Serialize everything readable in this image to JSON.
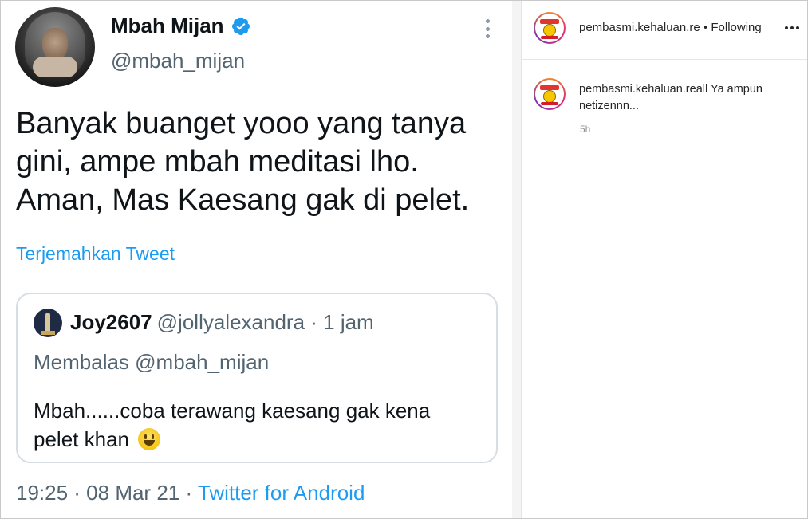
{
  "tweet": {
    "display_name": "Mbah Mijan",
    "handle": "@mbah_mijan",
    "text_lines": [
      "Banyak buanget yooo yang tanya",
      "gini, ampe mbah meditasi lho.",
      "Aman, Mas Kaesang gak di pelet."
    ],
    "translate_label": "Terjemahkan Tweet",
    "quote": {
      "name": "Joy2607",
      "handle_time": "@jollyalexandra · 1 jam",
      "reply_to": "Membalas @mbah_mijan",
      "text_line1": "Mbah......coba terawang kaesang gak kena",
      "text_line2": "pelet khan"
    },
    "timestamp": "19:25 · 08 Mar 21 · ",
    "source": "Twitter for Android"
  },
  "instagram": {
    "header_username": "pembasmi.kehaluan.re",
    "header_following": " • Following",
    "comment_username": "pembasmi.kehaluan.reall",
    "comment_text": " Ya ampun netizennn...",
    "comment_time": "5h"
  },
  "colors": {
    "link_blue": "#1d9bf0",
    "text_dark": "#0f1419",
    "text_gray": "#536471"
  }
}
